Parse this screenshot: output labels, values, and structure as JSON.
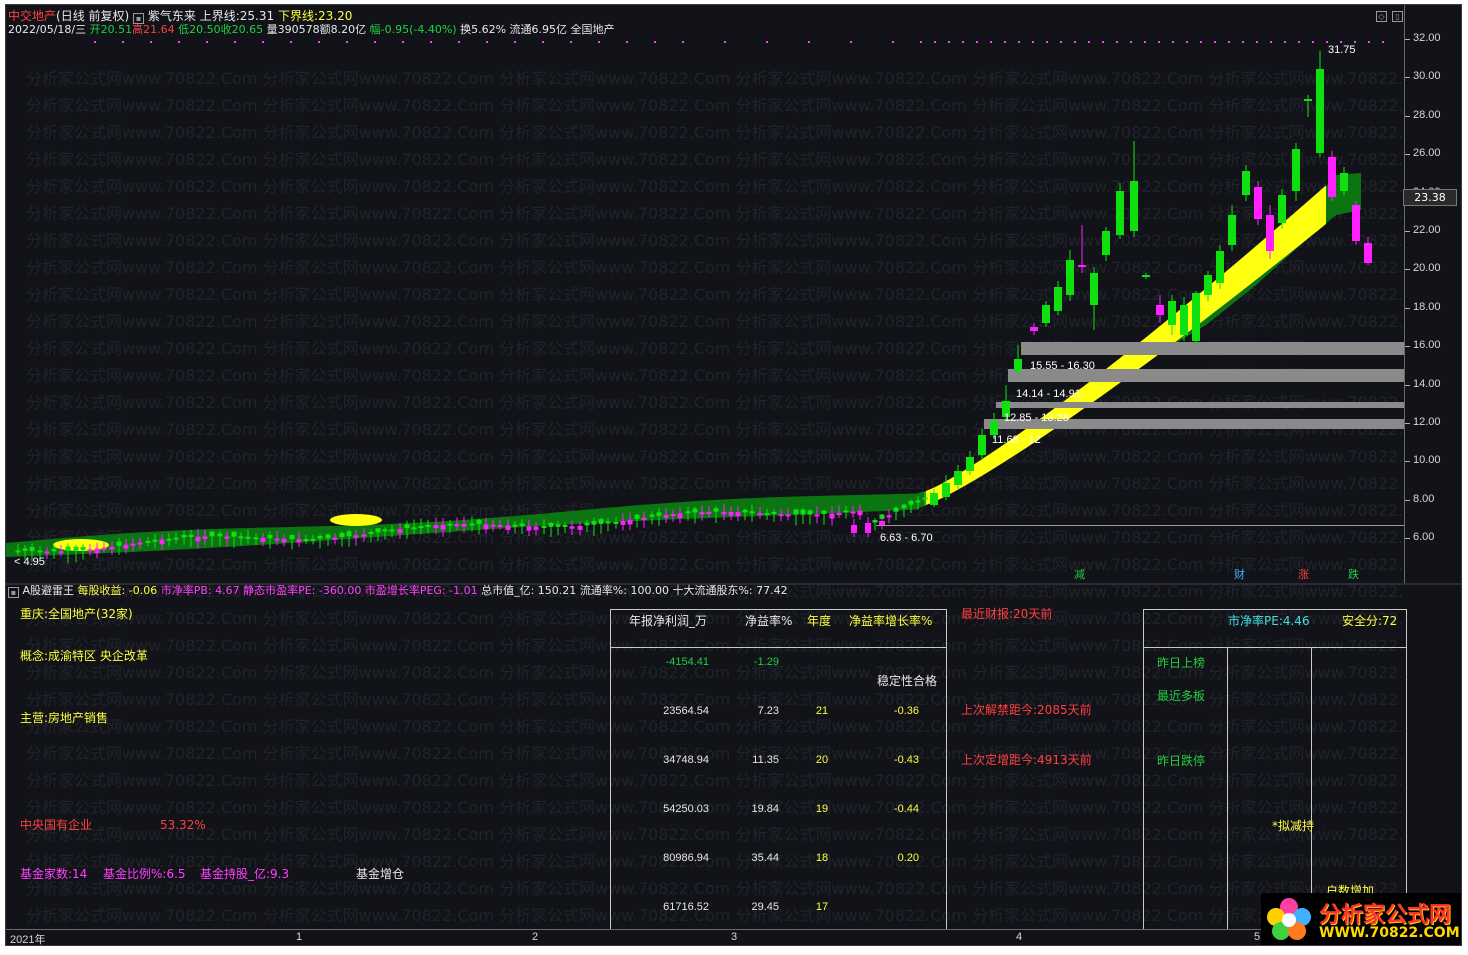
{
  "header": {
    "stock_name": "中交地产",
    "period": "(日线 前复权)",
    "indicator": "紫气东来",
    "upper_label": "上界线:",
    "upper_value": "25.31",
    "lower_label": "下界线:",
    "lower_value": "23.20"
  },
  "quote": {
    "date": "2022/05/18/三",
    "open": "开20.51",
    "high": "高21.64",
    "low": "低20.50",
    "close": "收20.65",
    "volume": "量390578",
    "amount": "额8.20亿",
    "change": "幅-0.95(-4.40%)",
    "turnover": "换5.62%",
    "float_cap": "流通6.95亿",
    "sector": "全国地产"
  },
  "price_axis": {
    "ticks": [
      "32.00",
      "30.00",
      "28.00",
      "26.00",
      "24.00",
      "22.00",
      "20.00",
      "18.00",
      "16.00",
      "14.00",
      "12.00",
      "10.00",
      "8.00",
      "6.00"
    ],
    "current": "23.38"
  },
  "chart_annotations": {
    "high_mark": "31.75",
    "low_mark": "4.95",
    "zones": [
      "15.55 - 16.30",
      "14.14 - 14.91",
      "12.85 - 13.28",
      "11.68 - 12"
    ],
    "bottom_zone": "6.63 - 6.70",
    "signals": [
      "减",
      "财",
      "涨",
      "跌"
    ]
  },
  "watermark": "分析家公式网www.70822.Com",
  "indicator_bar": {
    "name": "A股避雷王",
    "eps": "每股收益: -0.06",
    "pb": "市净率PB: 4.67",
    "pe": "静态市盈率PE: -360.00",
    "peg": "市盈增长率PEG: -1.01",
    "mcap": "总市值_亿: 150.21",
    "float_ratio": "流通率%: 100.00",
    "top10": "十大流通股东%: 77.42"
  },
  "info": {
    "region": "重庆:全国地产(32家)",
    "concept": "概念:成渝特区 央企改革",
    "business": "主营:房地产销售",
    "owner_label": "中央国有企业",
    "owner_pct": "53.32%",
    "fund_count": "基金家数:14",
    "fund_ratio": "基金比例%:6.5",
    "fund_shares": "基金持股_亿:9.3",
    "fund_trend": "基金增仓"
  },
  "fin_table": {
    "headers": [
      "年报净利润_万",
      "净益率%",
      "年度",
      "净益率增长率%"
    ],
    "first_row": {
      "profit": "-4154.41",
      "roe": "-1.29"
    },
    "stability": "稳定性合格",
    "rows": [
      {
        "profit": "23564.54",
        "roe": "7.23",
        "year": "21",
        "growth": "-0.36"
      },
      {
        "profit": "34748.94",
        "roe": "11.35",
        "year": "20",
        "growth": "-0.43"
      },
      {
        "profit": "54250.03",
        "roe": "19.84",
        "year": "19",
        "growth": "-0.44"
      },
      {
        "profit": "80986.94",
        "roe": "35.44",
        "year": "18",
        "growth": "0.20"
      },
      {
        "profit": "61716.52",
        "roe": "29.45",
        "year": "17",
        "growth": ""
      }
    ]
  },
  "events": {
    "report": "最近财报:20天前",
    "unlock": "上次解禁距今:2085天前",
    "placement": "上次定增距今:4913天前"
  },
  "right_table": {
    "pb_label": "市净率PE:4.46",
    "safety": "安全分:72",
    "items": [
      "昨日上榜",
      "最近多板",
      "昨日跌停"
    ],
    "reduce": "*拟减持",
    "holder_up": "户数增加"
  },
  "time_axis": [
    "2021年",
    "1",
    "2",
    "3",
    "4",
    "5"
  ],
  "logo": {
    "title": "分析家公式网",
    "url": "WWW.70822.COM"
  }
}
